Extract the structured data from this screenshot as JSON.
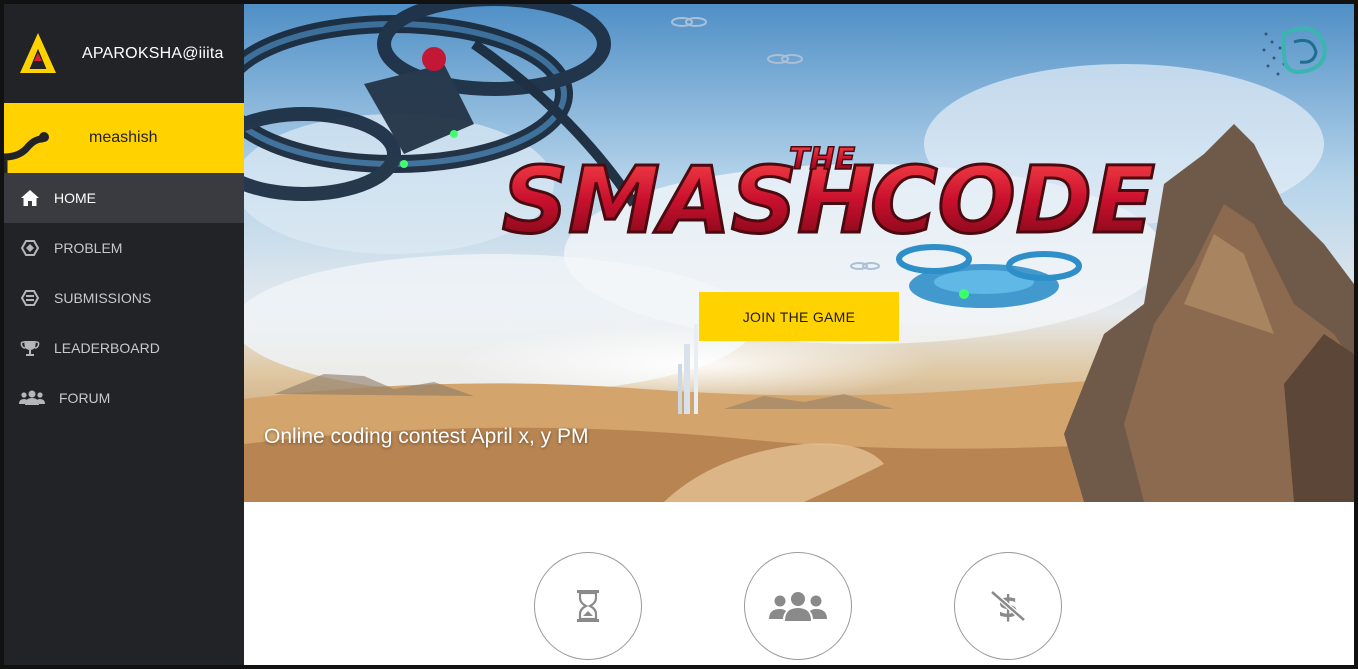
{
  "brand": {
    "name": "APAROKSHA@iiita",
    "logo_icon": "aparoksha-logo-icon"
  },
  "user": {
    "name": "meashish"
  },
  "nav": {
    "items": [
      {
        "label": "HOME",
        "icon": "home-icon",
        "active": true
      },
      {
        "label": "PROBLEM",
        "icon": "problem-icon",
        "active": false
      },
      {
        "label": "SUBMISSIONS",
        "icon": "submissions-icon",
        "active": false
      },
      {
        "label": "LEADERBOARD",
        "icon": "trophy-icon",
        "active": false
      },
      {
        "label": "FORUM",
        "icon": "users-icon",
        "active": false
      }
    ]
  },
  "hero": {
    "title_word_1": "SMASH",
    "title_word_2": "THE",
    "title_word_3": "CODE",
    "join_label": "JOIN THE GAME",
    "tagline": "Online coding contest April x, y PM"
  },
  "features": [
    {
      "icon": "hourglass-icon"
    },
    {
      "icon": "team-icon"
    },
    {
      "icon": "no-money-icon"
    }
  ],
  "colors": {
    "accent": "#ffd200",
    "sidebar_bg": "#222327",
    "sidebar_active": "#393b40",
    "title_red": "#c8102e"
  }
}
